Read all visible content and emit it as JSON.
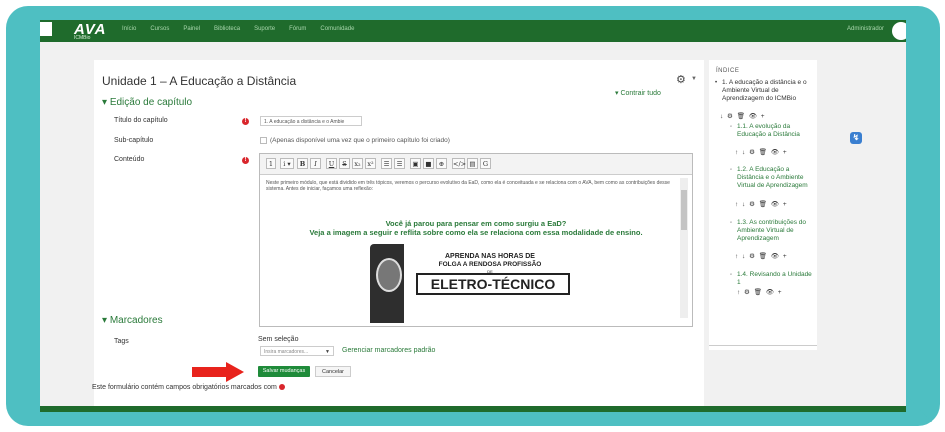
{
  "colors": {
    "bubble": "#4ebfc2",
    "brand_green": "#1f6b2c",
    "link_green": "#2a7a3a",
    "required_red": "#d9262c",
    "save_button": "#1f8b3a",
    "arrow_red": "#e8231c"
  },
  "topbar": {
    "logo": "AVA",
    "logo_sub": "ICMBio",
    "menu": [
      "Início",
      "Cursos",
      "Painel",
      "Biblioteca",
      "Suporte",
      "Fórum",
      "Comunidade"
    ],
    "user": "Administrador"
  },
  "page": {
    "title": "Unidade 1 – A Educação a Distância",
    "collapse_all": "Contrair tudo",
    "section_edit": "Edição de capítulo",
    "fields": {
      "titulo_label": "Título do capítulo",
      "titulo_value": "1. A educação a distância e o Ambie",
      "sub_label": "Sub-capítulo",
      "sub_note": "(Apenas disponível uma vez que o primeiro capítulo foi criado)",
      "conteudo_label": "Conteúdo"
    },
    "editor": {
      "toolbar": [
        "1",
        "i ▾",
        "B",
        "I",
        "U",
        "S",
        "x₂",
        "x²",
        "☰",
        "☰",
        "▣",
        "■",
        "⊕",
        "</>",
        "▤",
        "G"
      ],
      "intro_text": "Neste primeiro módulo, que está dividido em três tópicos, veremos o percurso evolutivo da EaD, como ela é conceituada e se relaciona com o AVA, bem como as contribuições desse sistema. Antes de iniciar, façamos uma reflexão:",
      "question_line1": "Você já parou para pensar em como surgiu a EaD?",
      "question_line2": "Veja a imagem a seguir e reflita sobre como ela se relaciona com essa modalidade de ensino.",
      "ad_line1": "APRENDA NAS HORAS DE",
      "ad_line2": "FOLGA A RENDOSA PROFISSÃO",
      "ad_de": "DE",
      "ad_line3": "ELETRO-TÉCNICO"
    },
    "section_tags": "Marcadores",
    "tags": {
      "label": "Tags",
      "selection": "Sem seleção",
      "placeholder": "Insira marcadores...",
      "manage_link": "Gerenciar marcadores padrão"
    },
    "buttons": {
      "save": "Salvar mudanças",
      "cancel": "Cancelar"
    },
    "footnote": "Este formulário contém campos obrigatórios marcados com"
  },
  "sidebar": {
    "title": "ÍNDICE",
    "main_item": "1. A educação a distância e o Ambiente Virtual de Aprendizagem do ICMBio",
    "main_icons": "↓ ⚙ 🗑 👁 +",
    "items": [
      {
        "label": "1.1. A evolução da Educação a Distância",
        "icons": "↑ ↓ ⚙ 🗑 👁 +"
      },
      {
        "label": "1.2. A Educação a Distância e o Ambiente Virtual de Aprendizagem",
        "icons": "↑ ↓ ⚙ 🗑 👁 +"
      },
      {
        "label": "1.3. As contribuições do Ambiente Virtual de Aprendizagem",
        "icons": "↑ ↓ ⚙ 🗑 👁 +"
      },
      {
        "label": "1.4. Revisando a Unidade 1",
        "icons": "↑ ⚙ 🗑 👁 +"
      }
    ]
  }
}
